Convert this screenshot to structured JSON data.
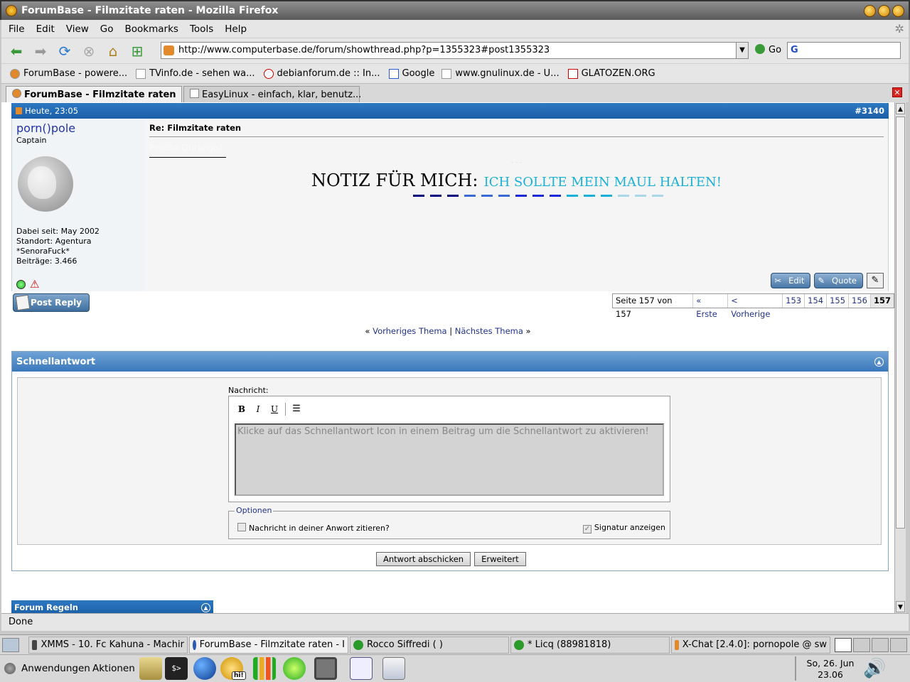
{
  "window": {
    "title": "ForumBase - Filmzitate raten - Mozilla Firefox"
  },
  "menu": [
    "File",
    "Edit",
    "View",
    "Go",
    "Bookmarks",
    "Tools",
    "Help"
  ],
  "nav": {
    "url": "http://www.computerbase.de/forum/showthread.php?p=1355323#post1355323",
    "go_label": "Go",
    "search_value": "G"
  },
  "bookmarks": [
    "ForumBase - powere...",
    "TVinfo.de - sehen wa...",
    "debianforum.de :: In...",
    "Google",
    "www.gnulinux.de - U...",
    "GLATOZEN.ORG"
  ],
  "tabs": [
    {
      "label": "ForumBase - Filmzitate raten"
    },
    {
      "label": "EasyLinux - einfach, klar, benutz..."
    }
  ],
  "post": {
    "date": "Heute, 23:05",
    "number": "#3140",
    "user": {
      "name": "porn()pole",
      "rank": "Captain",
      "joined": "Dabei seit: May 2002",
      "location": "Standort: Agentura",
      "extra": "*SenoraFuck*",
      "posts": "Beiträge: 3.466"
    },
    "title": "Re: Filmzitate raten",
    "body_hidden": "Perdita Durango?",
    "sig_small": "- - -",
    "sig_main": "NOTIZ FÜR MICH:",
    "sig_sub": "ICH SOLLTE MEIN MAUL HALTEN!",
    "buttons": {
      "edit": "Edit",
      "quote": "Quote"
    }
  },
  "post_reply_label": "Post Reply",
  "pager": {
    "info": "Seite 157 von 157",
    "first": "« Erste",
    "prev": "< Vorherige",
    "pages": [
      "153",
      "154",
      "155",
      "156"
    ],
    "current": "157"
  },
  "thread_nav": {
    "left": "«",
    "prev": "Vorheriges Thema",
    "sep": "|",
    "next": "Nächstes Thema",
    "right": "»"
  },
  "quick_reply": {
    "title": "Schnellantwort",
    "message_label": "Nachricht:",
    "toolbar": [
      "B",
      "I",
      "U"
    ],
    "placeholder": "Klicke auf das Schnellantwort Icon in einem Beitrag um die Schnellantwort zu aktivieren!",
    "options_legend": "Optionen",
    "quote_option": "Nachricht in deiner Anwort zitieren?",
    "sig_option": "Signatur anzeigen",
    "submit": "Antwort abschicken",
    "advanced": "Erweitert"
  },
  "rules_title": "Forum Regeln",
  "status": "Done",
  "taskbar": [
    "XMMS - 10. Fc Kahuna - Machir",
    "ForumBase - Filmzitate raten - I",
    "Rocco Siffredi ( )",
    "* Licq (88981818)",
    "X-Chat [2.4.0]: pornopole @ sw"
  ],
  "panel": {
    "applications": "Anwendungen",
    "actions": "Aktionen",
    "hi_label": "hi!",
    "date": "So, 26. Jun",
    "time": "23.06"
  },
  "colors": {
    "accent_blue": "#1b5fa8",
    "sig_blue": "#19b0d8"
  }
}
